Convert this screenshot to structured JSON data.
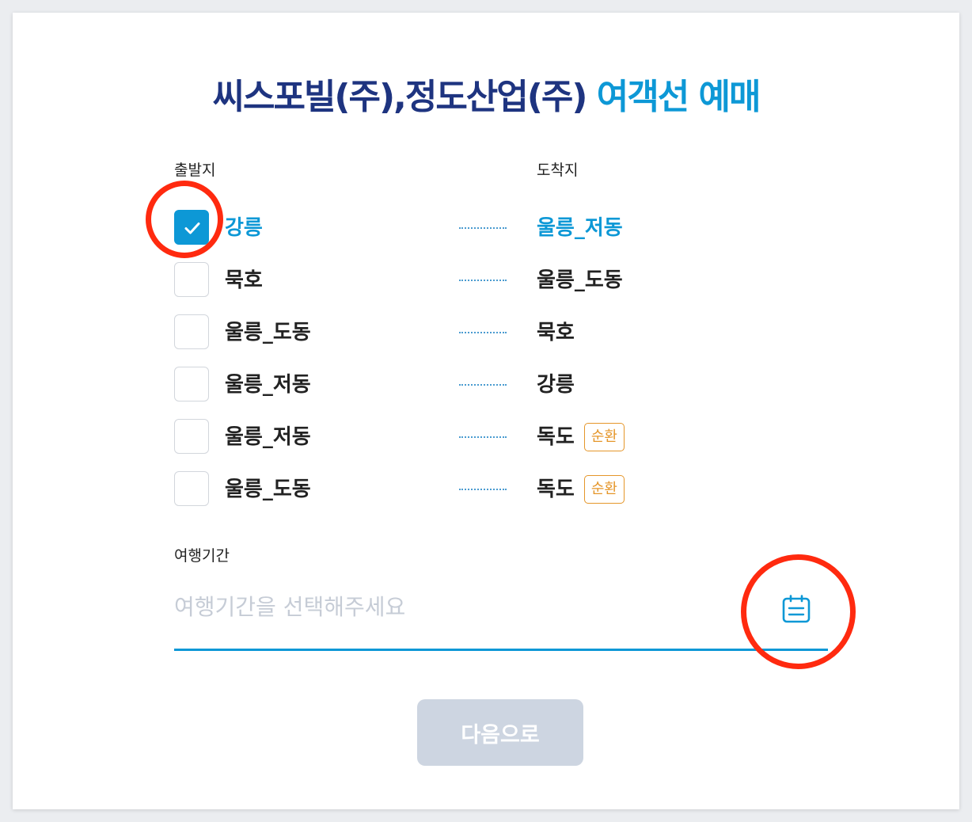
{
  "title": {
    "part1": "씨스포빌(주),정도산업(주) ",
    "part2": "여객선 예매"
  },
  "labels": {
    "departure": "출발지",
    "arrival": "도착지",
    "period": "여행기간"
  },
  "routes": [
    {
      "departure": "강릉",
      "arrival": "울릉_저동",
      "checked": true,
      "badge": ""
    },
    {
      "departure": "묵호",
      "arrival": "울릉_도동",
      "checked": false,
      "badge": ""
    },
    {
      "departure": "울릉_도동",
      "arrival": "묵호",
      "checked": false,
      "badge": ""
    },
    {
      "departure": "울릉_저동",
      "arrival": "강릉",
      "checked": false,
      "badge": ""
    },
    {
      "departure": "울릉_저동",
      "arrival": "독도",
      "checked": false,
      "badge": "순환"
    },
    {
      "departure": "울릉_도동",
      "arrival": "독도",
      "checked": false,
      "badge": "순환"
    }
  ],
  "period": {
    "value": "",
    "placeholder": "여행기간을 선택해주세요",
    "icon": "calendar-icon"
  },
  "next_button": {
    "label": "다음으로",
    "disabled": true
  },
  "colors": {
    "brand_dark": "#1e3480",
    "accent": "#0d98d6",
    "badge": "#e5962a",
    "button_disabled": "#cdd5e1",
    "annotation": "#ff2a0f"
  }
}
